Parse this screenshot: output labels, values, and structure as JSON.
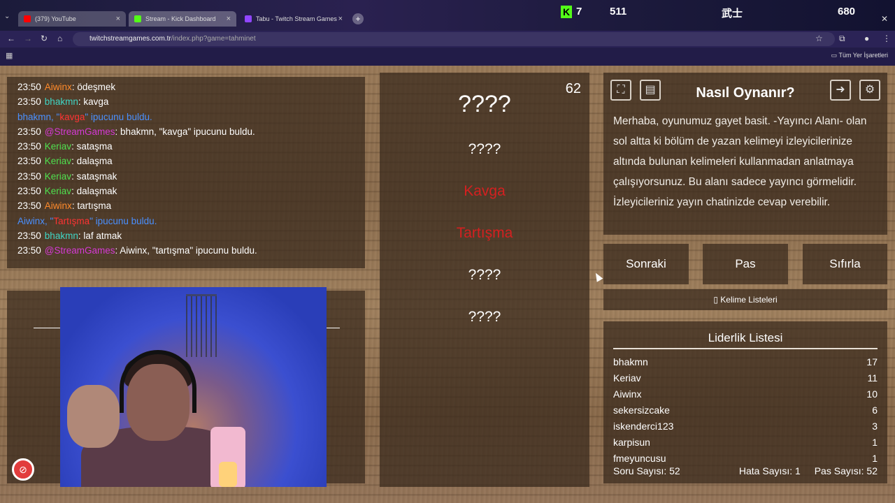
{
  "browser": {
    "tabs": [
      {
        "label": "(379) YouTube",
        "color": "#ff0000"
      },
      {
        "label": "Stream - Kick Dashboard",
        "color": "#53fc18"
      },
      {
        "label": "Tabu - Twitch Stream Games",
        "color": "#9146ff"
      }
    ],
    "url_host": "twitchstreamgames.com.tr",
    "url_path": "/index.php?game=tahminet",
    "bookmarks_label": "Tüm Yer İşaretleri"
  },
  "overlay": {
    "kick_count": "7",
    "viewers": "511",
    "name": "武士",
    "right_count": "680"
  },
  "chat": [
    {
      "time": "23:50",
      "user": "Aiwinx",
      "user_color": "#ff8a2a",
      "msg": "ödeşmek"
    },
    {
      "time": "23:50",
      "user": "bhakmn",
      "user_color": "#3fd6c6",
      "msg": "kavga"
    },
    {
      "system": true,
      "pre": "bhakmn, \"",
      "word": "kavga",
      "post": "\" ipucunu buldu."
    },
    {
      "time": "23:50",
      "user": "@StreamGames",
      "user_color": "#d63ad6",
      "msg": "bhakmn, \"kavga\" ipucunu buldu."
    },
    {
      "time": "23:50",
      "user": "Keriav",
      "user_color": "#4fe04f",
      "msg": "sataşma"
    },
    {
      "time": "23:50",
      "user": "Keriav",
      "user_color": "#4fe04f",
      "msg": "dalaşma"
    },
    {
      "time": "23:50",
      "user": "Keriav",
      "user_color": "#4fe04f",
      "msg": "sataşmak"
    },
    {
      "time": "23:50",
      "user": "Keriav",
      "user_color": "#4fe04f",
      "msg": "dalaşmak"
    },
    {
      "time": "23:50",
      "user": "Aiwinx",
      "user_color": "#ff8a2a",
      "msg": "tartışma"
    },
    {
      "system": true,
      "pre": "Aiwinx, \"",
      "word": "Tartışma",
      "post": "\" ipucunu buldu."
    },
    {
      "time": "23:50",
      "user": "bhakmn",
      "user_color": "#3fd6c6",
      "msg": "laf atmak"
    },
    {
      "time": "23:50",
      "user": "@StreamGames",
      "user_color": "#d63ad6",
      "msg": "Aiwinx, \"tartışma\" ipucunu buldu."
    }
  ],
  "game": {
    "timer": "62",
    "main_word": "????",
    "hints": [
      {
        "text": "????",
        "found": false
      },
      {
        "text": "Kavga",
        "found": true
      },
      {
        "text": "Tartışma",
        "found": true
      },
      {
        "text": "????",
        "found": false
      },
      {
        "text": "????",
        "found": false
      }
    ]
  },
  "howto": {
    "title": "Nasıl Oynanır?",
    "text": "Merhaba, oyunumuz gayet basit. -Yayıncı Alanı- olan sol altta ki bölüm de yazan kelimeyi izleyicilerinize altında bulunan kelimeleri kullanmadan anlatmaya çalışıyorsunuz. Bu alanı sadece yayıncı görmelidir. İzleyicileriniz yayın chatinizde cevap verebilir."
  },
  "buttons": {
    "next": "Sonraki",
    "pass": "Pas",
    "reset": "Sıfırla",
    "word_lists": "Kelime Listeleri"
  },
  "leaderboard": {
    "title": "Liderlik Listesi",
    "rows": [
      {
        "name": "bhakmn",
        "score": "17"
      },
      {
        "name": "Keriav",
        "score": "11"
      },
      {
        "name": "Aiwinx",
        "score": "10"
      },
      {
        "name": "sekersizcake",
        "score": "6"
      },
      {
        "name": "iskenderci123",
        "score": "3"
      },
      {
        "name": "karpisun",
        "score": "1"
      },
      {
        "name": "fmeyuncusu",
        "score": "1"
      }
    ],
    "question_count": "Soru Sayısı: 52",
    "error_count": "Hata Sayısı: 1",
    "pass_count": "Pas Sayısı: 52"
  }
}
